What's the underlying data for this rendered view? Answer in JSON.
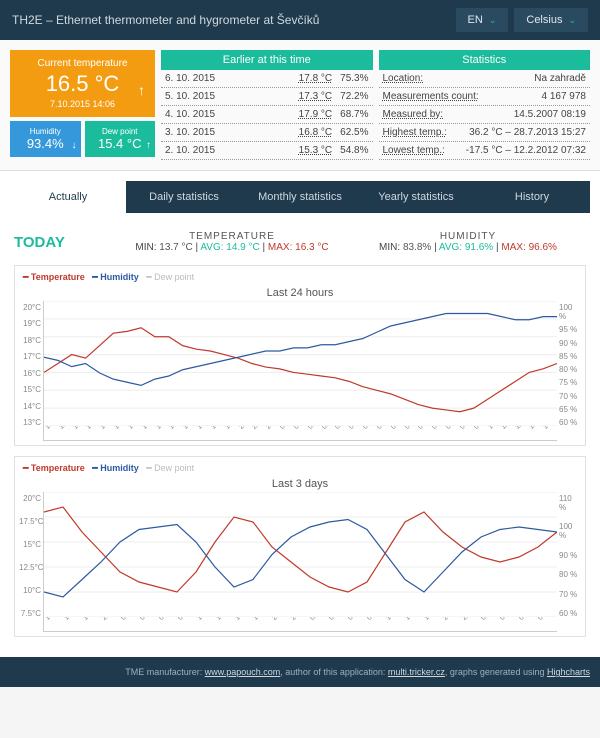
{
  "header": {
    "title": "TH2E – Ethernet thermometer and hygrometer at Ševčíků",
    "lang": "EN",
    "unit": "Celsius"
  },
  "current": {
    "label": "Current temperature",
    "value": "16.5 °C",
    "arrow": "↑",
    "datetime": "7.10.2015 14:06"
  },
  "humidity": {
    "label": "Humidity",
    "value": "93.4%",
    "arrow": "↓"
  },
  "dewpoint": {
    "label": "Dew point",
    "value": "15.4 °C",
    "arrow": "↑"
  },
  "earlier": {
    "title": "Earlier at this time",
    "rows": [
      {
        "d": "6. 10. 2015",
        "t": "17.8 °C",
        "h": "75.3%"
      },
      {
        "d": "5. 10. 2015",
        "t": "17.3 °C",
        "h": "72.2%"
      },
      {
        "d": "4. 10. 2015",
        "t": "17.9 °C",
        "h": "68.7%"
      },
      {
        "d": "3. 10. 2015",
        "t": "16.8 °C",
        "h": "62.5%"
      },
      {
        "d": "2. 10. 2015",
        "t": "15.3 °C",
        "h": "54.8%"
      }
    ]
  },
  "stats": {
    "title": "Statistics",
    "rows": [
      {
        "k": "Location:",
        "v": "Na zahradě"
      },
      {
        "k": "Measurements count:",
        "v": "4 167 978"
      },
      {
        "k": "Measured by:",
        "v": "14.5.2007 08:19"
      },
      {
        "k": "Highest temp.:",
        "v": "36.2 °C – 28.7.2013 15:27"
      },
      {
        "k": "Lowest temp.:",
        "v": "-17.5 °C – 12.2.2012 07:32"
      }
    ]
  },
  "tabs": [
    "Actually",
    "Daily statistics",
    "Monthly statistics",
    "Yearly statistics",
    "History"
  ],
  "today": {
    "label": "TODAY",
    "temp": {
      "title": "TEMPERATURE",
      "min": "13.7 °C",
      "avg": "14.9 °C",
      "max": "16.3 °C"
    },
    "hum": {
      "title": "HUMIDITY",
      "min": "83.8%",
      "avg": "91.6%",
      "max": "96.6%"
    }
  },
  "legend": {
    "t": "Temperature",
    "h": "Humidity",
    "d": "Dew point"
  },
  "chart_data": [
    {
      "type": "line",
      "title": "Last 24 hours",
      "y_left": {
        "label": "°C",
        "min": 13,
        "max": 20,
        "ticks": [
          "20°C",
          "19°C",
          "18°C",
          "17°C",
          "16°C",
          "15°C",
          "14°C",
          "13°C"
        ]
      },
      "y_right": {
        "label": "%",
        "min": 60,
        "max": 100,
        "ticks": [
          "100 %",
          "95 %",
          "90 %",
          "85 %",
          "80 %",
          "75 %",
          "70 %",
          "65 %",
          "60 %"
        ]
      },
      "x": [
        "12:29",
        "12:58",
        "13:24",
        "13:49",
        "14:22",
        "14:47",
        "15:25",
        "16:09",
        "16:47",
        "17:22",
        "17:55",
        "18:38",
        "19:09",
        "19:58",
        "21:13",
        "22:22",
        "23:13",
        "00:03",
        "00:52",
        "01:30",
        "02:05",
        "02:46",
        "03:24",
        "04:26",
        "05:01",
        "05:42",
        "06:17",
        "07:02",
        "07:39",
        "08:29",
        "09:10",
        "09:53",
        "10:34",
        "11:19",
        "11:52",
        "12:46",
        "13:29",
        "14:05"
      ],
      "series": [
        {
          "name": "Temperature",
          "color": "#c0392b",
          "axis": "left",
          "values": [
            16.0,
            16.5,
            17.0,
            16.8,
            17.5,
            18.2,
            18.3,
            18.5,
            18.0,
            18.0,
            17.5,
            17.3,
            17.2,
            17.0,
            16.8,
            16.5,
            16.3,
            16.2,
            16.0,
            15.9,
            15.8,
            15.7,
            15.5,
            15.2,
            15.0,
            14.8,
            14.5,
            14.2,
            14.0,
            13.9,
            13.8,
            14.0,
            14.5,
            15.0,
            15.5,
            16.0,
            16.2,
            16.5
          ]
        },
        {
          "name": "Humidity",
          "color": "#2c5aa0",
          "axis": "right",
          "values": [
            82,
            81,
            79,
            80,
            77,
            75,
            74,
            73,
            75,
            76,
            78,
            79,
            80,
            81,
            82,
            83,
            84,
            84,
            85,
            85,
            86,
            86,
            87,
            88,
            90,
            92,
            93,
            94,
            95,
            96,
            96,
            96,
            96,
            95,
            94,
            94,
            95,
            95
          ]
        }
      ]
    },
    {
      "type": "line",
      "title": "Last 3 days",
      "y_left": {
        "label": "°C",
        "min": 7.5,
        "max": 20,
        "ticks": [
          "20°C",
          "17.5°C",
          "15°C",
          "12.5°C",
          "10°C",
          "7.5°C"
        ]
      },
      "y_right": {
        "label": "%",
        "min": 60,
        "max": 110,
        "ticks": [
          "110 %",
          "100 %",
          "90 %",
          "80 %",
          "70 %",
          "60 %"
        ]
      },
      "x": [
        "14:09",
        "16:27",
        "19:11",
        "21:49",
        "00:19",
        "03:19",
        "05:43",
        "08:20",
        "10:24",
        "13:08",
        "15:49",
        "18:18",
        "21:08",
        "23:44",
        "02:16",
        "04:49",
        "07:25",
        "09:57",
        "13:27",
        "15:03",
        "17:40",
        "20:14",
        "22:49",
        "01:22",
        "03:56",
        "06:30",
        "09:08",
        "11:38"
      ],
      "series": [
        {
          "name": "Temperature",
          "color": "#c0392b",
          "axis": "left",
          "values": [
            18.0,
            18.5,
            16.0,
            14.0,
            12.0,
            11.0,
            10.5,
            10.0,
            12.0,
            15.0,
            17.5,
            17.0,
            14.5,
            13.0,
            11.5,
            10.5,
            10.0,
            11.0,
            14.0,
            17.0,
            18.0,
            16.0,
            14.5,
            13.5,
            13.0,
            13.5,
            14.5,
            16.0
          ]
        },
        {
          "name": "Humidity",
          "color": "#2c5aa0",
          "axis": "right",
          "values": [
            70,
            68,
            75,
            82,
            90,
            95,
            96,
            97,
            90,
            80,
            72,
            75,
            85,
            92,
            96,
            98,
            99,
            95,
            85,
            75,
            70,
            78,
            86,
            92,
            95,
            96,
            95,
            94
          ]
        }
      ]
    }
  ],
  "footer": {
    "text": "TME manufacturer: ",
    "l1": "www.papouch.com",
    "mid": ", author of this application: ",
    "l2": "multi.tricker.cz",
    "end": ", graphs generated using ",
    "l3": "Highcharts"
  }
}
